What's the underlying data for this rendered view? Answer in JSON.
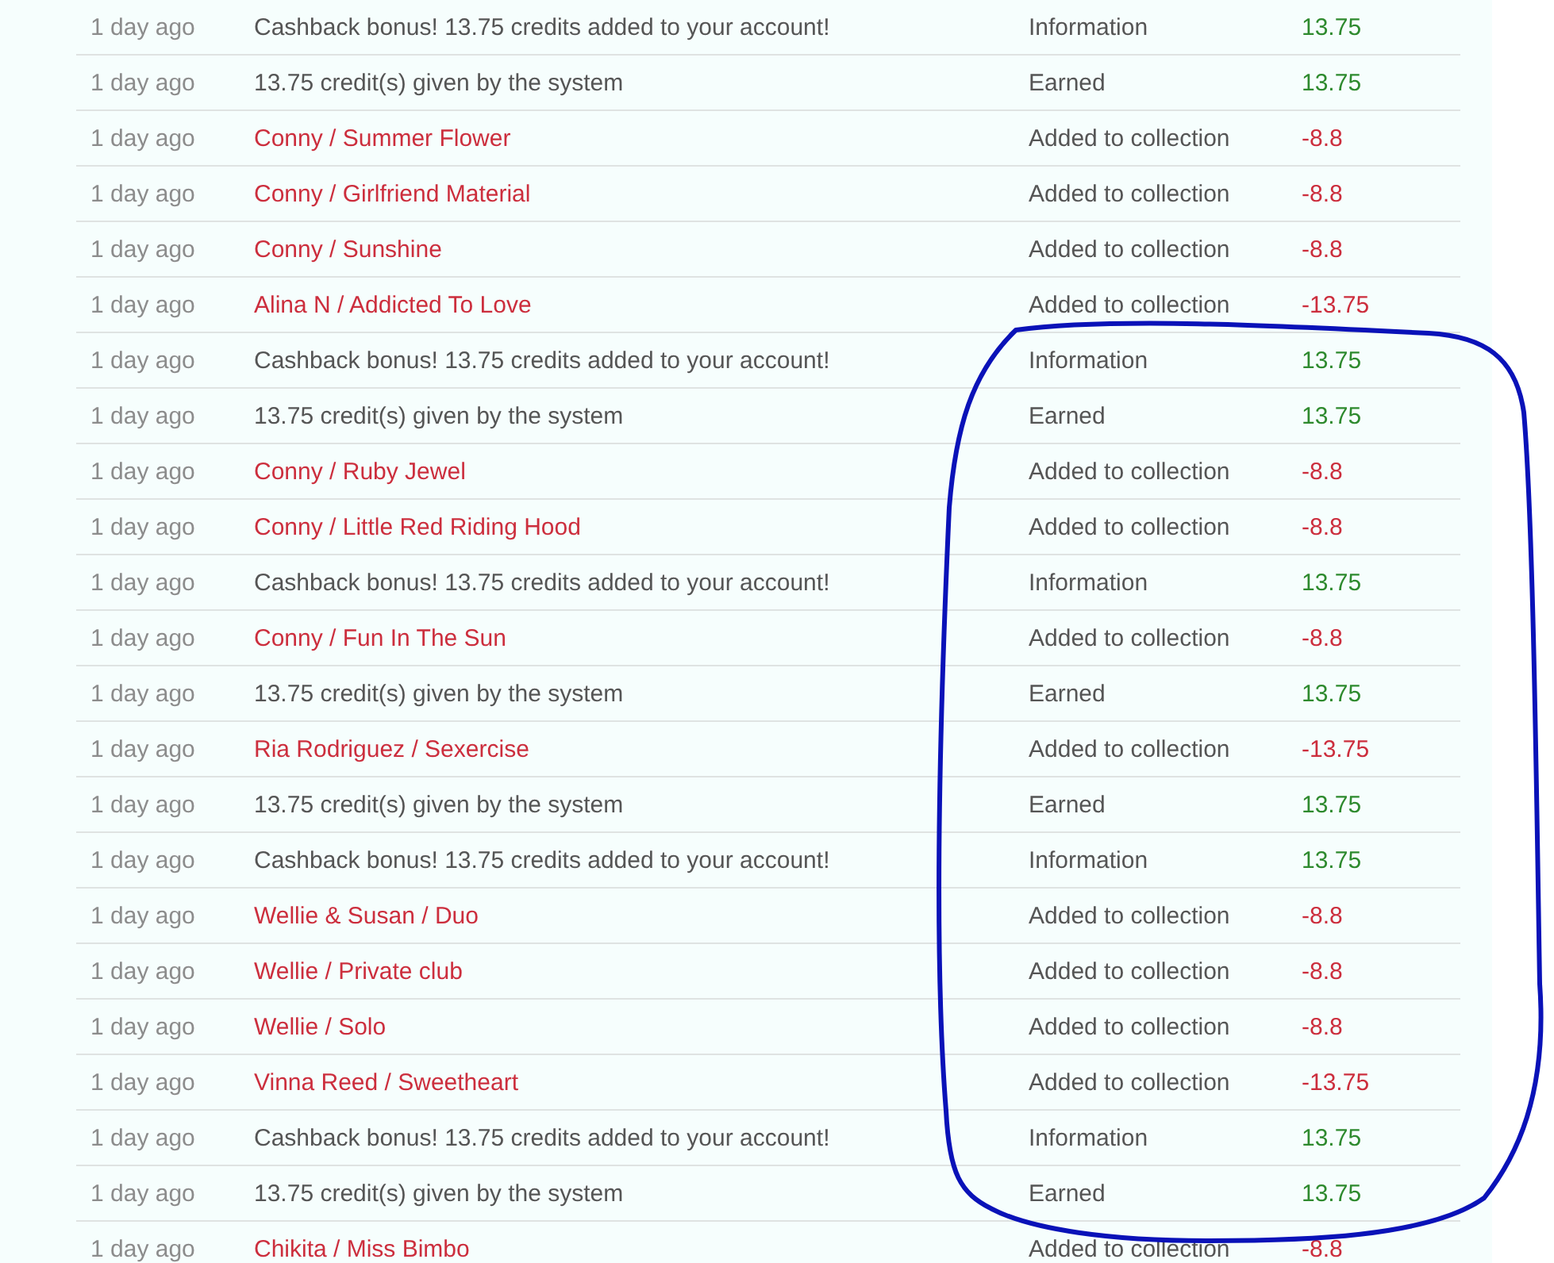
{
  "transactions": [
    {
      "time": "1 day ago",
      "description": "Cashback bonus! 13.75 credits added to your account!",
      "kind": "system",
      "type": "Information",
      "amount": "13.75"
    },
    {
      "time": "1 day ago",
      "description": "13.75 credit(s) given by the system",
      "kind": "system",
      "type": "Earned",
      "amount": "13.75"
    },
    {
      "time": "1 day ago",
      "description": "Conny / Summer Flower",
      "kind": "purchase",
      "type": "Added to collection",
      "amount": "-8.8"
    },
    {
      "time": "1 day ago",
      "description": "Conny / Girlfriend Material",
      "kind": "purchase",
      "type": "Added to collection",
      "amount": "-8.8"
    },
    {
      "time": "1 day ago",
      "description": "Conny / Sunshine",
      "kind": "purchase",
      "type": "Added to collection",
      "amount": "-8.8"
    },
    {
      "time": "1 day ago",
      "description": "Alina N / Addicted To Love",
      "kind": "purchase",
      "type": "Added to collection",
      "amount": "-13.75"
    },
    {
      "time": "1 day ago",
      "description": "Cashback bonus! 13.75 credits added to your account!",
      "kind": "system",
      "type": "Information",
      "amount": "13.75"
    },
    {
      "time": "1 day ago",
      "description": "13.75 credit(s) given by the system",
      "kind": "system",
      "type": "Earned",
      "amount": "13.75"
    },
    {
      "time": "1 day ago",
      "description": "Conny / Ruby Jewel",
      "kind": "purchase",
      "type": "Added to collection",
      "amount": "-8.8"
    },
    {
      "time": "1 day ago",
      "description": "Conny / Little Red Riding Hood",
      "kind": "purchase",
      "type": "Added to collection",
      "amount": "-8.8"
    },
    {
      "time": "1 day ago",
      "description": "Cashback bonus! 13.75 credits added to your account!",
      "kind": "system",
      "type": "Information",
      "amount": "13.75"
    },
    {
      "time": "1 day ago",
      "description": "Conny / Fun In The Sun",
      "kind": "purchase",
      "type": "Added to collection",
      "amount": "-8.8"
    },
    {
      "time": "1 day ago",
      "description": "13.75 credit(s) given by the system",
      "kind": "system",
      "type": "Earned",
      "amount": "13.75"
    },
    {
      "time": "1 day ago",
      "description": "Ria Rodriguez / Sexercise",
      "kind": "purchase",
      "type": "Added to collection",
      "amount": "-13.75"
    },
    {
      "time": "1 day ago",
      "description": "13.75 credit(s) given by the system",
      "kind": "system",
      "type": "Earned",
      "amount": "13.75"
    },
    {
      "time": "1 day ago",
      "description": "Cashback bonus! 13.75 credits added to your account!",
      "kind": "system",
      "type": "Information",
      "amount": "13.75"
    },
    {
      "time": "1 day ago",
      "description": "Wellie & Susan / Duo",
      "kind": "purchase",
      "type": "Added to collection",
      "amount": "-8.8"
    },
    {
      "time": "1 day ago",
      "description": "Wellie / Private club",
      "kind": "purchase",
      "type": "Added to collection",
      "amount": "-8.8"
    },
    {
      "time": "1 day ago",
      "description": "Wellie / Solo",
      "kind": "purchase",
      "type": "Added to collection",
      "amount": "-8.8"
    },
    {
      "time": "1 day ago",
      "description": "Vinna Reed / Sweetheart",
      "kind": "purchase",
      "type": "Added to collection",
      "amount": "-13.75"
    },
    {
      "time": "1 day ago",
      "description": "Cashback bonus! 13.75 credits added to your account!",
      "kind": "system",
      "type": "Information",
      "amount": "13.75"
    },
    {
      "time": "1 day ago",
      "description": "13.75 credit(s) given by the system",
      "kind": "system",
      "type": "Earned",
      "amount": "13.75"
    },
    {
      "time": "1 day ago",
      "description": "Chikita / Miss Bimbo",
      "kind": "purchase",
      "type": "Added to collection",
      "amount": "-8.8"
    }
  ]
}
